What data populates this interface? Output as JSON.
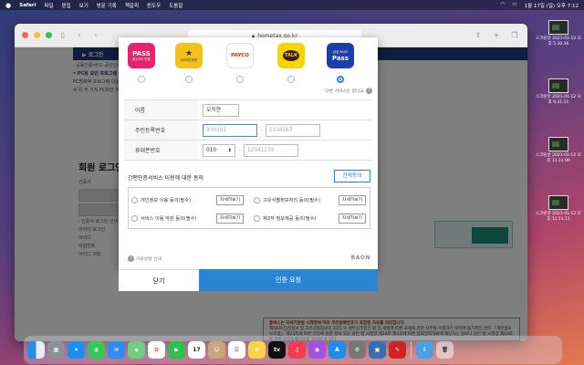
{
  "menubar": {
    "apple": "",
    "app": "Safari",
    "items": [
      "파일",
      "편집",
      "보기",
      "방문 기록",
      "책갈피",
      "윈도우",
      "도움말"
    ],
    "datetime": "1월 17일 (일) 오후 7:12"
  },
  "browser": {
    "url": "hometax.go.kr"
  },
  "page": {
    "nav": "▶ 로그인",
    "left_lines": [
      "· 공동인증서(구 공인인증서)",
      "• PC용 보안 프로그램",
      "PC방화벽 프로그램 다운로드",
      "※ 위 두 가지 PC보안 재설치"
    ],
    "heading": "회원 로그인",
    "side": [
      "인증서",
      "공동인증서 로그인",
      "간편인증 로그인",
      "· 인증서 로그인 안내",
      "아이디 로그인",
      "아이디",
      "비밀번호",
      "아이디 저장"
    ],
    "bottom_title": "홈택스는 국세기본법 시행령에 따라 주민등록번호가 포함된 자료를 처리합니다.",
    "bottom_text": "제68조(민감정보 및 고유식별정보의 처리) ① 세무공무원은 법 및 세법에 따른 국세에 관한 사무를 수행하기 위하여 불가피한 경우 「개인정보 보호법」 제23조에 따른 건강에 관한 정보 또는 같은 법 시행령 제18조 제2호에 따른 범죄경력자료에 해당하는 정보나 같은 법 시행령 제19조에 따른 주민등록번호를 처리할 수 있다."
  },
  "modal": {
    "providers": [
      {
        "name": "PASS",
        "sub": "통신3사 인증",
        "color": "#e5246b",
        "top": "통신사PASS"
      },
      {
        "name": "KB",
        "sub": "KB국민은행",
        "color": "#f5c11a",
        "top": "KB인증"
      },
      {
        "name": "PAYCO",
        "sub": "",
        "color": "#ffffff",
        "top": ""
      },
      {
        "name": "TALK",
        "sub": "",
        "color": "#f7d500",
        "top": ""
      },
      {
        "name": "Pass",
        "sub": "삼성 PASS",
        "color": "#1a3fa8",
        "top": ""
      }
    ],
    "other_services": "다른 서비스는 없나요",
    "name_label": "이름",
    "name_value": "오지현",
    "rrn_label": "주민등록번호",
    "rrn_front_placeholder": "900101",
    "rrn_back_placeholder": "1234567",
    "phone_label": "휴대폰번호",
    "phone_prefix": "010",
    "phone_placeholder": "12341234",
    "consent_title": "간편인증서비스 이용에 대한 동의",
    "agree_all": "전체동의",
    "consents": [
      {
        "label": "개인정보 이용 동의(필수)",
        "view": "자세히보기"
      },
      {
        "label": "고유식별정보처리 동의(필수)",
        "view": "자세히보기"
      },
      {
        "label": "서비스 이용 약관 동의(필수)",
        "view": "자세히보기"
      },
      {
        "label": "제3자 정보제공 동의(필수)",
        "view": "자세히보기"
      }
    ],
    "guide": "사용방법 안내",
    "brand": "RAON",
    "close_label": "닫기",
    "request_label": "인증 요청"
  },
  "desktop": {
    "thumbs": [
      "스크린샷 2021-01-12 오후 5.30.36",
      "스크린샷 2021-01-12 오후 9.31.11",
      "스크린샷 2021-01-12 오후 11.11.00",
      "스크린샷 2021-01-12 오후 11.11.11"
    ]
  },
  "dock": [
    "Finder",
    "Launchpad",
    "Safari",
    "Messages",
    "Mail",
    "Maps",
    "Photos",
    "FaceTime",
    "17",
    "Contacts",
    "Reminders",
    "Notes",
    "TV",
    "Music",
    "Podcasts",
    "App Store",
    "System Preferences",
    "Preview",
    "Acrobat",
    "Downloads",
    "Trash"
  ]
}
